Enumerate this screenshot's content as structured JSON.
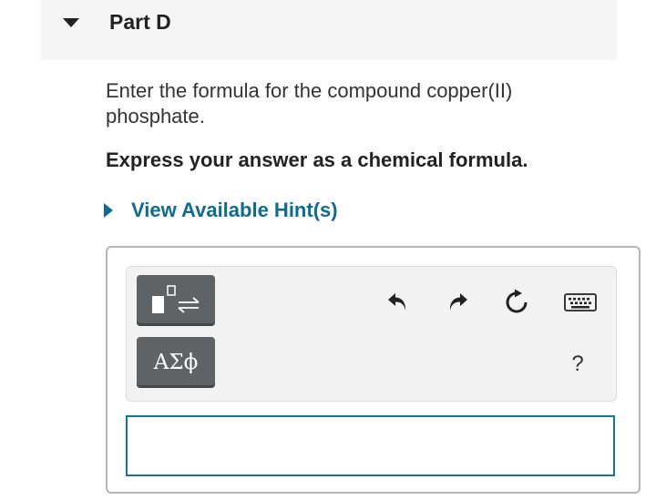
{
  "part": {
    "title": "Part D"
  },
  "question": {
    "prompt": "Enter the formula for the compound copper(II) phosphate.",
    "instruction": "Express your answer as a chemical formula."
  },
  "hint": {
    "label": "View Available Hint(s)"
  },
  "toolbar": {
    "templates_icon": "templates-reaction-arrow-icon",
    "symbols_label": "ΑΣϕ",
    "undo_icon": "undo-icon",
    "redo_icon": "redo-icon",
    "reset_icon": "reset-icon",
    "keyboard_icon": "keyboard-icon",
    "help_label": "?"
  },
  "answer": {
    "value": "",
    "placeholder": ""
  },
  "colors": {
    "link": "#0f6b8c",
    "input_border": "#1a7593",
    "tool_button": "#5f6366"
  }
}
